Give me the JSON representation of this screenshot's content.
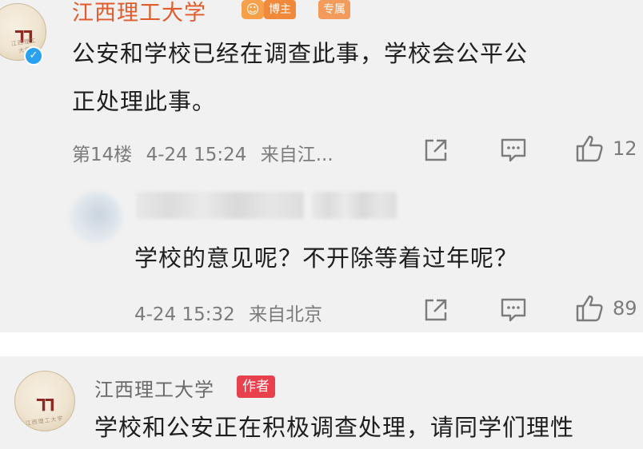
{
  "comment1": {
    "username": "江西理工大学",
    "badges": {
      "fan_icon": "sun-face-icon",
      "host": "博主",
      "exclusive": "专属"
    },
    "text_line1": "公安和学校已经在调查此事，学校会公平公",
    "text_line2": "正处理此事。",
    "floor": "第14楼",
    "datetime": "4-24 15:24",
    "source": "来自江...",
    "like_count": "12"
  },
  "reply": {
    "text": "学校的意见呢？不开除等着过年呢？",
    "datetime": "4-24 15:32",
    "source": "来自北京",
    "like_count": "89"
  },
  "comment2": {
    "username": "江西理工大学",
    "badge": "作者",
    "text": "学校和公安正在积极调查处理，请同学们理性"
  },
  "avatar": {
    "logo": "ㄲ",
    "ring_text": "江西理工大学"
  },
  "icons": {
    "share": "share-icon",
    "comment": "comment-icon",
    "like": "thumbs-up-icon",
    "verified": "verified-badge-icon"
  },
  "colors": {
    "username": "#e05c2d",
    "badge_host": "#f08a3a",
    "badge_exclusive": "#f29b5a",
    "badge_author": "#e8404d",
    "verified": "#2aa1f0",
    "background": "#f1f1f1"
  }
}
